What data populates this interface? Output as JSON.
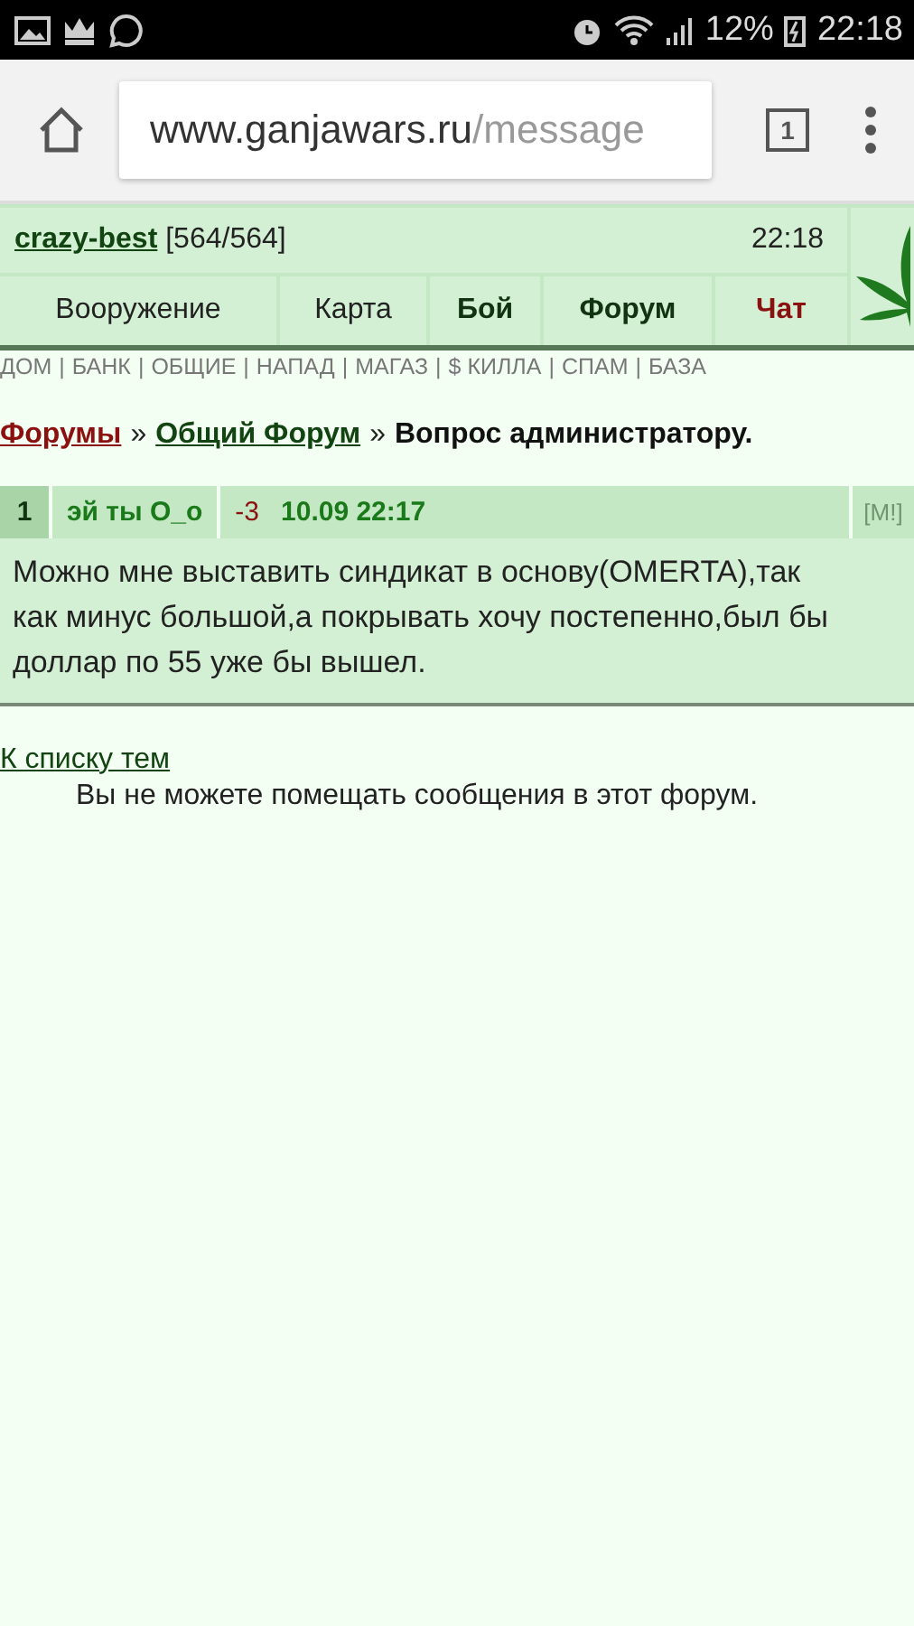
{
  "status_bar": {
    "battery": "12%",
    "time": "22:18"
  },
  "browser": {
    "url_host": "www.ganjawars.ru",
    "url_path": "/message",
    "tab_count": "1"
  },
  "header": {
    "user": "crazy-best",
    "hp": "[564/564]",
    "time": "22:18"
  },
  "nav": [
    {
      "label": "Вооружение",
      "kind": "normal"
    },
    {
      "label": "Карта",
      "kind": "normal"
    },
    {
      "label": "Бой",
      "kind": "bold"
    },
    {
      "label": "Форум",
      "kind": "bold"
    },
    {
      "label": "Чат",
      "kind": "alert"
    }
  ],
  "quick_links": {
    "separator": "|",
    "items": [
      "ДОМ",
      "БАНК",
      "ОБЩИЕ",
      "НАПАД",
      "МАГАЗ",
      "$ КИЛЛА",
      "СПАМ",
      "БАЗА"
    ]
  },
  "breadcrumb": {
    "separator": "»",
    "items": [
      {
        "label": "Форумы",
        "kind": "red"
      },
      {
        "label": "Общий Форум",
        "kind": "green"
      },
      {
        "label": "Вопрос администратору.",
        "kind": "current"
      }
    ]
  },
  "post": {
    "number": "1",
    "author": "эй ты О_о",
    "rating": "-3",
    "date": "10.09 22:17",
    "flag": "[M!]",
    "body": "Можно мне выставить синдикат в основу(OMERTA),так как минус большой,а покрывать хочу постепенно,был бы доллар по 55 уже бы вышел."
  },
  "back_link": "К списку тем",
  "notice": "Вы не можете помещать сообщения в этот форум."
}
